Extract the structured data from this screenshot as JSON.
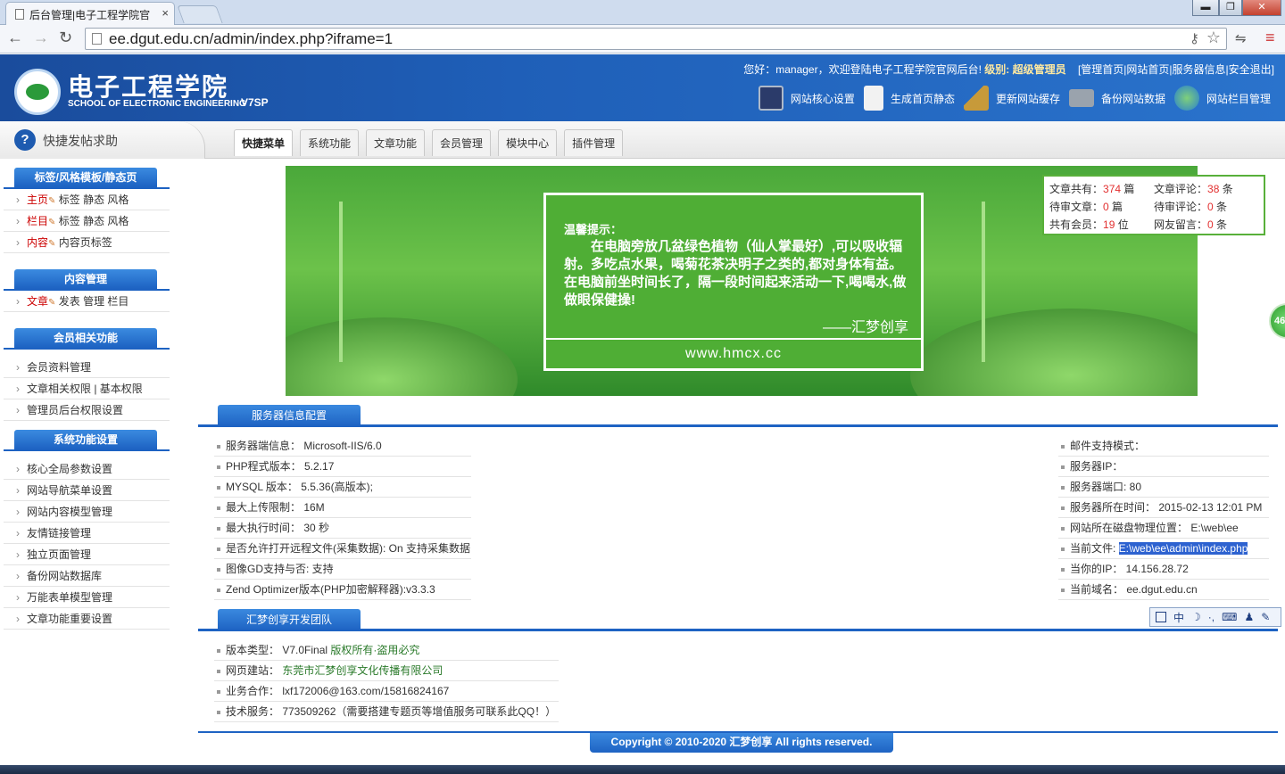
{
  "browser": {
    "tab_title": "后台管理|电子工程学院官",
    "tab_close": "×",
    "url": "ee.dgut.edu.cn/admin/index.php?iframe=1",
    "back_icon": "←",
    "forward_icon": "→",
    "reload_icon": "↻",
    "win_min": "▬",
    "win_max": "❐",
    "win_close": "✕",
    "menu_icon": "≡",
    "star_icon": "☆",
    "key_icon": "⚷"
  },
  "header": {
    "title": "电子工程学院",
    "subtitle": "SCHOOL OF ELECTRONIC ENGINEERING",
    "version": "V7SP",
    "welcome_prefix": "您好：manager，欢迎登陆电子工程学院官网后台!",
    "level_label": "级别: 超级管理员",
    "links": [
      "[管理首页",
      "|网站首页",
      "|服务器信息",
      "|安全退出]"
    ],
    "quick": [
      {
        "label": "网站核心设置",
        "icon": "monitor-icon",
        "color": "#2b3b6a"
      },
      {
        "label": "生成首页静态",
        "icon": "document-icon",
        "color": "#eaeaea"
      },
      {
        "label": "更新网站缓存",
        "icon": "broom-icon",
        "color": "#c79a3a"
      },
      {
        "label": "备份网站数据",
        "icon": "harddisk-icon",
        "color": "#9aa3ad"
      },
      {
        "label": "网站栏目管理",
        "icon": "globe-icon",
        "color": "#3aa04a"
      }
    ]
  },
  "menubar": {
    "help": "快捷发帖求助",
    "tabs": [
      "快捷菜单",
      "系统功能",
      "文章功能",
      "会员管理",
      "模块中心",
      "插件管理"
    ]
  },
  "sidebar": {
    "sections": [
      {
        "title": "标签/风格模板/静态页",
        "items": [
          {
            "red": "主页",
            "text": "标签 静态 风格"
          },
          {
            "red": "栏目",
            "text": "标签 静态 风格"
          },
          {
            "red": "内容",
            "text": "内容页标签"
          }
        ]
      },
      {
        "title": "内容管理",
        "items": [
          {
            "red": "文章",
            "text": "发表 管理 栏目"
          }
        ]
      },
      {
        "title": "会员相关功能",
        "items": [
          {
            "red": "",
            "text": "会员资料管理"
          },
          {
            "red": "",
            "text": "文章相关权限 | 基本权限"
          },
          {
            "red": "",
            "text": "管理员后台权限设置"
          }
        ]
      },
      {
        "title": "系统功能设置",
        "items": [
          {
            "red": "",
            "text": "核心全局参数设置"
          },
          {
            "red": "",
            "text": "网站导航菜单设置"
          },
          {
            "red": "",
            "text": "网站内容模型管理"
          },
          {
            "red": "",
            "text": "友情链接管理"
          },
          {
            "red": "",
            "text": "独立页面管理"
          },
          {
            "red": "",
            "text": "备份网站数据库"
          },
          {
            "red": "",
            "text": "万能表单模型管理"
          },
          {
            "red": "",
            "text": "文章功能重要设置"
          }
        ]
      }
    ]
  },
  "banner": {
    "notice_title": "温馨提示：",
    "notice_body": "在电脑旁放几盆绿色植物（仙人掌最好）,可以吸收辐射。多吃点水果，喝菊花茶决明子之类的,都对身体有益。在电脑前坐时间长了，隔一段时间起来活动一下,喝喝水,做做眼保健操!",
    "notice_sign": "——汇梦创享",
    "notice_url": "www.hmcx.cc"
  },
  "stats": [
    [
      {
        "label": "文章共有：",
        "value": "374",
        "unit": " 篇"
      },
      {
        "label": "文章评论：",
        "value": "38",
        "unit": " 条"
      }
    ],
    [
      {
        "label": "待审文章：",
        "value": "0",
        "unit": " 篇"
      },
      {
        "label": "待审评论：",
        "value": "0",
        "unit": " 条"
      }
    ],
    [
      {
        "label": "共有会员：",
        "value": "19",
        "unit": " 位"
      },
      {
        "label": "网友留言：",
        "value": "0",
        "unit": " 条"
      }
    ]
  ],
  "float_badge": "46",
  "server": {
    "title": "服务器信息配置",
    "left": [
      "服务器端信息： Microsoft-IIS/6.0",
      "PHP程式版本： 5.2.17",
      "MYSQL 版本： 5.5.36(高版本);",
      "最大上传限制： 16M",
      "最大执行时间： 30 秒",
      "是否允许打开远程文件(采集数据): On 支持采集数据",
      "图像GD支持与否: 支持",
      "Zend Optimizer版本(PHP加密解释器):v3.3.3"
    ],
    "right": [
      "邮件支持模式：",
      "服务器IP：",
      "服务器端口: 80",
      "服务器所在时间： 2015-02-13 12:01 PM",
      "网站所在磁盘物理位置： E:\\web\\ee",
      "当前文件: ",
      "当你的IP： 14.156.28.72",
      "当前域名： ee.dgut.edu.cn"
    ],
    "current_file": "E:\\web\\ee\\admin\\index.php"
  },
  "team": {
    "title": "汇梦创享开发团队",
    "rows": [
      {
        "label": "版本类型： V7.0Final ",
        "green": "版权所有·盗用必究"
      },
      {
        "label": "网页建站： ",
        "green": "东莞市汇梦创享文化传播有限公司"
      },
      {
        "label": "业务合作： lxf172006@163.com/15816824167",
        "green": ""
      },
      {
        "label": "技术服务： 773509262（需要搭建专题页等增值服务可联系此QQ！）",
        "green": ""
      }
    ]
  },
  "copyright": "Copyright © 2010-2020 汇梦创享 All rights reserved.",
  "ime": [
    "中",
    "☽",
    "·,",
    "⌨",
    "♟",
    "✎"
  ]
}
